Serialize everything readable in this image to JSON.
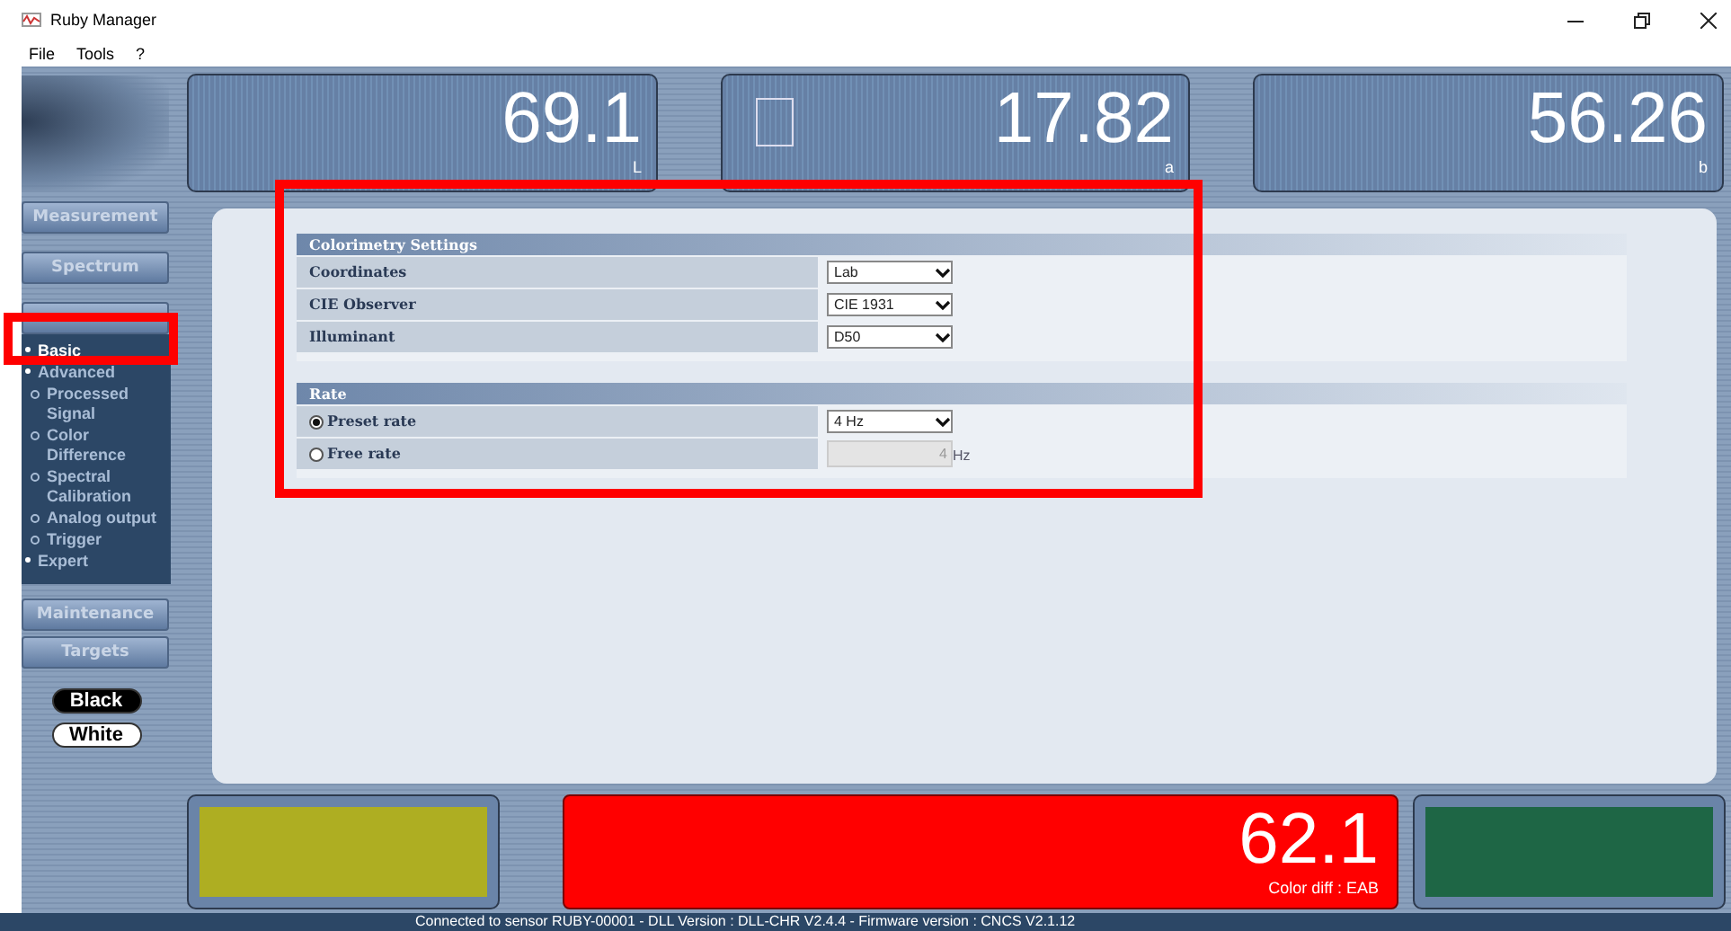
{
  "window": {
    "title": "Ruby Manager"
  },
  "menu": [
    "File",
    "Tools",
    "?"
  ],
  "meters": [
    {
      "value": "69.1",
      "label": "L",
      "square_marker": false
    },
    {
      "value": "17.82",
      "label": "a",
      "square_marker": true
    },
    {
      "value": "56.26",
      "label": "b",
      "square_marker": false
    }
  ],
  "sidebar": {
    "buttons_top": [
      "Measurement",
      "Spectrum"
    ],
    "config_items": [
      {
        "label": "Basic",
        "kind": "main",
        "selected": true
      },
      {
        "label": "Advanced",
        "kind": "main",
        "selected": false
      },
      {
        "label": "Processed Signal",
        "kind": "sub",
        "selected": false
      },
      {
        "label": "Color Difference",
        "kind": "sub",
        "selected": false
      },
      {
        "label": "Spectral Calibration",
        "kind": "sub",
        "selected": false
      },
      {
        "label": "Analog output",
        "kind": "sub",
        "selected": false
      },
      {
        "label": "Trigger",
        "kind": "sub",
        "selected": false
      },
      {
        "label": "Expert",
        "kind": "main",
        "selected": false
      }
    ],
    "buttons_bottom": [
      "Maintenance",
      "Targets"
    ],
    "references": [
      {
        "label": "Black",
        "kind": "black"
      },
      {
        "label": "White",
        "kind": "white"
      }
    ]
  },
  "colorimetry": {
    "title": "Colorimetry Settings",
    "rows": [
      {
        "label": "Coordinates",
        "value": "Lab"
      },
      {
        "label": "CIE Observer",
        "value": "CIE 1931"
      },
      {
        "label": "Illuminant",
        "value": "D50"
      }
    ]
  },
  "rate": {
    "title": "Rate",
    "options": [
      {
        "label": "Preset rate",
        "selected": true,
        "kind": "select",
        "value": "4 Hz"
      },
      {
        "label": "Free rate",
        "selected": false,
        "kind": "number",
        "value": "4",
        "unit": "Hz",
        "disabled": true
      }
    ]
  },
  "color_diff": {
    "value": "62.1",
    "label": "Color diff : EAB"
  },
  "status_bar": "Connected to sensor RUBY-00001 - DLL Version : DLL-CHR V2.4.4 - Firmware version : CNCS V2.1.12"
}
